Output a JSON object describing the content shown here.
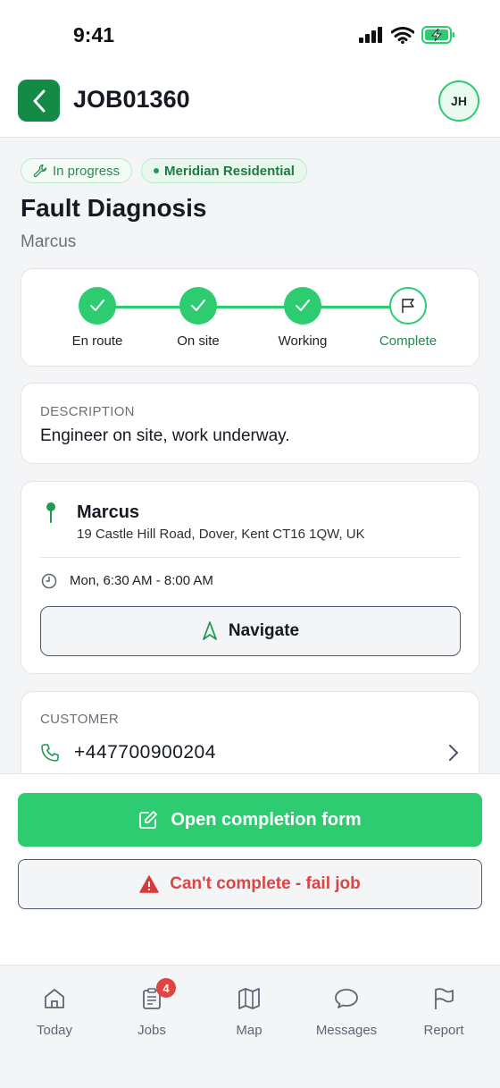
{
  "status_bar": {
    "time": "9:41"
  },
  "header": {
    "title": "JOB01360",
    "avatar_initials": "JH"
  },
  "chips": {
    "status": "In progress",
    "client": "Meridian Residential"
  },
  "job": {
    "title": "Fault Diagnosis",
    "subtitle": "Marcus"
  },
  "progress": {
    "steps": [
      {
        "label": "En route",
        "state": "done"
      },
      {
        "label": "On site",
        "state": "done"
      },
      {
        "label": "Working",
        "state": "done"
      },
      {
        "label": "Complete",
        "state": "current"
      }
    ]
  },
  "description": {
    "label": "DESCRIPTION",
    "text": "Engineer on site, work underway."
  },
  "location": {
    "name": "Marcus",
    "address": "19 Castle Hill Road, Dover, Kent CT16 1QW, UK",
    "time": "Mon, 6:30 AM - 8:00 AM",
    "navigate_label": "Navigate"
  },
  "customer": {
    "label": "CUSTOMER",
    "phone": "+447700900204"
  },
  "actions": {
    "primary_label": "Open completion form",
    "fail_label": "Can't complete - fail job"
  },
  "tabs": [
    {
      "label": "Today",
      "icon": "home-icon"
    },
    {
      "label": "Jobs",
      "icon": "clipboard-icon",
      "badge": "4"
    },
    {
      "label": "Map",
      "icon": "map-icon"
    },
    {
      "label": "Messages",
      "icon": "chat-bubble-icon"
    },
    {
      "label": "Report",
      "icon": "flag-icon"
    }
  ],
  "colors": {
    "accent": "#2ecc71",
    "accent_dark": "#138a45",
    "danger": "#d94646",
    "background": "#f4f5f7"
  }
}
